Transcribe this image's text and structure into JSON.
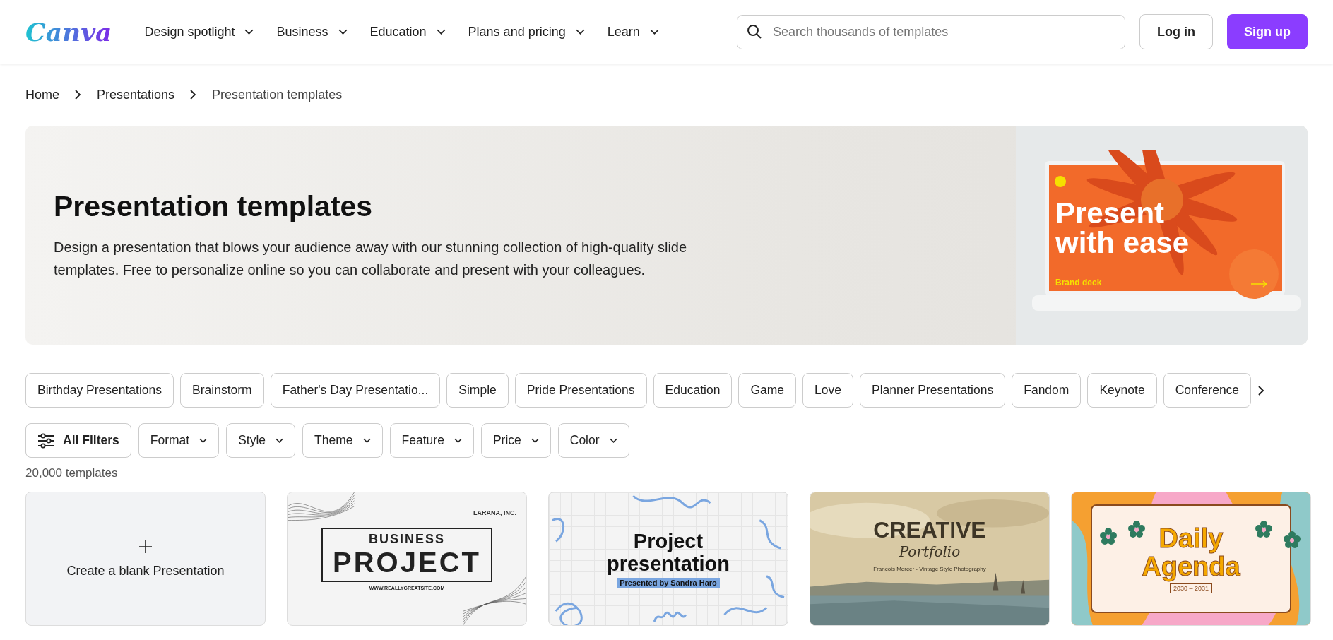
{
  "header": {
    "logo": "Canva",
    "nav": [
      {
        "label": "Design spotlight"
      },
      {
        "label": "Business"
      },
      {
        "label": "Education"
      },
      {
        "label": "Plans and pricing"
      },
      {
        "label": "Learn"
      }
    ],
    "search": {
      "placeholder": "Search thousands of templates"
    },
    "buttons": [
      {
        "label": "Log in",
        "kind": "secondary"
      },
      {
        "label": "Sign up",
        "kind": "primary"
      }
    ]
  },
  "breadcrumb": [
    "Home",
    "Presentations",
    "Presentation templates"
  ],
  "hero": {
    "title": "Presentation templates",
    "description": "Design a presentation that blows your audience away with our stunning collection of high-quality slide templates. Free to personalize online so you can collaborate and present with your colleagues.",
    "slide": {
      "headline_1": "Present",
      "headline_2": "with ease",
      "caption": "Brand deck"
    }
  },
  "chips": [
    "Birthday Presentations",
    "Brainstorm",
    "Father's Day Presentatio...",
    "Simple",
    "Pride Presentations",
    "Education",
    "Game",
    "Love",
    "Planner Presentations",
    "Fandom",
    "Keynote",
    "Conference"
  ],
  "filters": {
    "all": "All Filters",
    "dropdowns": [
      "Format",
      "Style",
      "Theme",
      "Feature",
      "Price",
      "Color"
    ]
  },
  "count": "20,000 templates",
  "cards": [
    {
      "kind": "blank",
      "label": "Create a blank Presentation"
    },
    {
      "kind": "business",
      "texts": [
        "LARANA, INC.",
        "BUSINESS",
        "PROJECT",
        "WWW.REALLYGREATSITE.COM"
      ]
    },
    {
      "kind": "project",
      "texts": [
        "Project",
        "presentation",
        "Presented by Sandra Haro"
      ]
    },
    {
      "kind": "creative",
      "texts": [
        "CREATIVE",
        "Portfolio",
        "Francois Mercer - Vintage Style Photography"
      ]
    },
    {
      "kind": "agenda",
      "texts": [
        "Daily",
        "Agenda",
        "2030 – 2031"
      ]
    }
  ]
}
